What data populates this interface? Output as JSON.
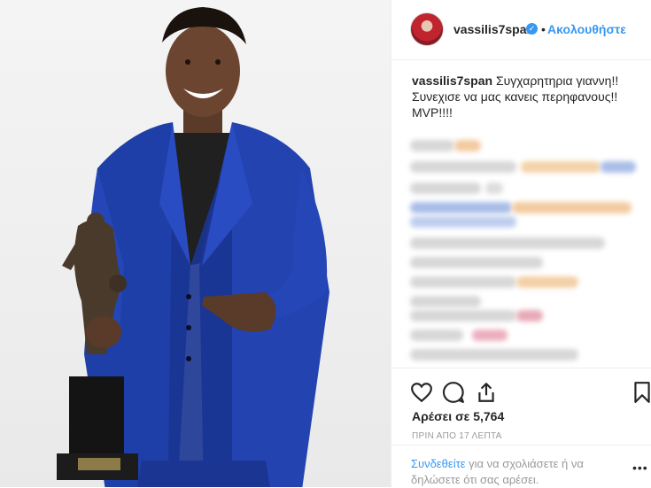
{
  "post": {
    "username": "vassilis7span",
    "follow_label": "Ακολουθήστε",
    "dot": "•",
    "caption_user": "vassilis7span",
    "caption_text": "Συγχαρητηρια γιαννη!!Συνεχισε να μας κανεις περηφανους!! MVP!!!!",
    "likes": "Αρέσει σε 5,764",
    "time": "ΠΡΙΝ ΑΠΟ 17 ΛΕΠΤΑ",
    "login_link": "Συνδεθείτε",
    "login_rest": " για να σχολιάσετε ή να δηλώσετε ότι σας αρέσει.",
    "more": "•••"
  },
  "icons": {
    "verified": "verified-badge-icon",
    "like": "heart-icon",
    "comment": "comment-bubble-icon",
    "share": "share-icon",
    "save": "bookmark-icon"
  },
  "colors": {
    "accent": "#3897f0",
    "suit": "#1f3fa8",
    "muted": "#999999"
  }
}
